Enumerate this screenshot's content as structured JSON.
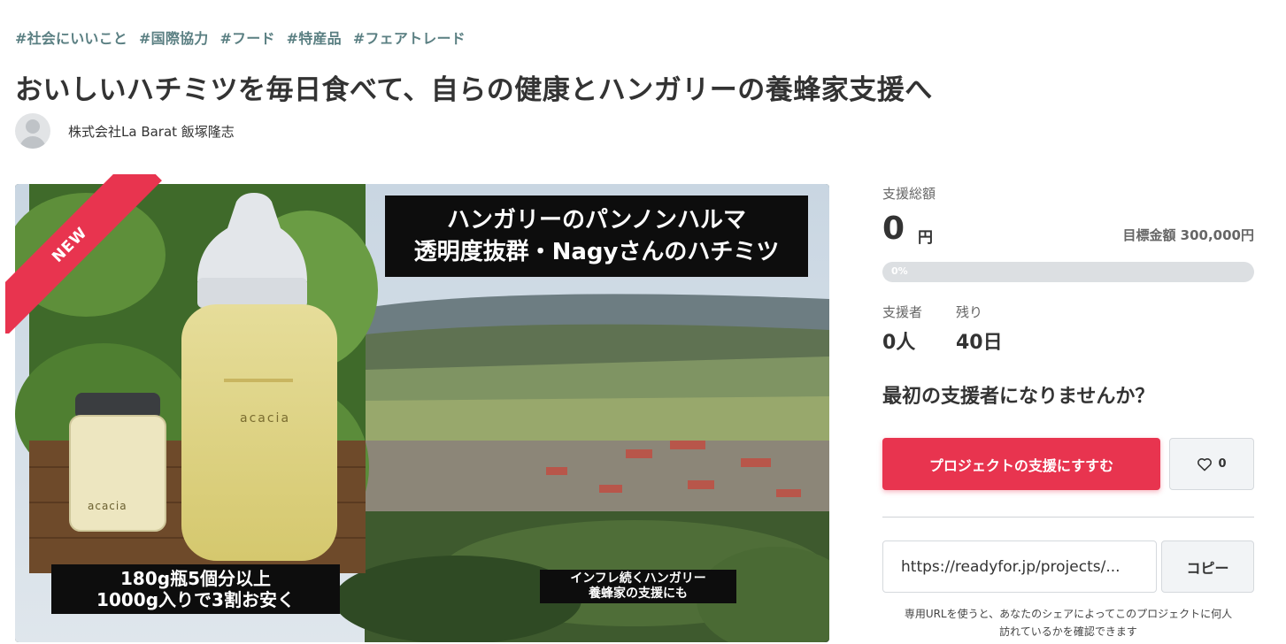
{
  "tags": [
    "#社会にいいこと",
    "#国際協力",
    "#フード",
    "#特産品",
    "#フェアトレード"
  ],
  "title": "おいしいハチミツを毎日食べて、自らの健康とハンガリーの養蜂家支援へ",
  "owner": {
    "name": "株式会社La Barat 飯塚隆志"
  },
  "hero": {
    "ribbon": "NEW",
    "caption_top_line1": "ハンガリーのパンノンハルマ",
    "caption_top_line2": "透明度抜群・Nagyさんのハチミツ",
    "caption_left_line1": "180g瓶5個分以上",
    "caption_left_line2": "1000g入りで3割お安く",
    "caption_right_line1": "インフレ続くハンガリー",
    "caption_right_line2": "養蜂家の支援にも",
    "label_small": "acacia",
    "label_large": "acacia"
  },
  "funding": {
    "total_label": "支援総額",
    "amount": "0",
    "currency": "円",
    "goal": "目標金額 300,000円",
    "progress_text": "0%",
    "progress_value": 0,
    "supporters_label": "支援者",
    "supporters": "0人",
    "remaining_label": "残り",
    "remaining": "40日"
  },
  "cta": {
    "prompt": "最初の支援者になりませんか？",
    "support_button": "プロジェクトの支援にすすむ",
    "favorite_count": "0"
  },
  "share": {
    "url": "https://readyfor.jp/projects/...",
    "copy_button": "コピー",
    "note": "専用URLを使うと、あなたのシェアによってこのプロジェクトに何人訪れているかを確認できます"
  },
  "colors": {
    "accent": "#e8344f",
    "tag": "#5a7f82",
    "text": "#333333"
  }
}
